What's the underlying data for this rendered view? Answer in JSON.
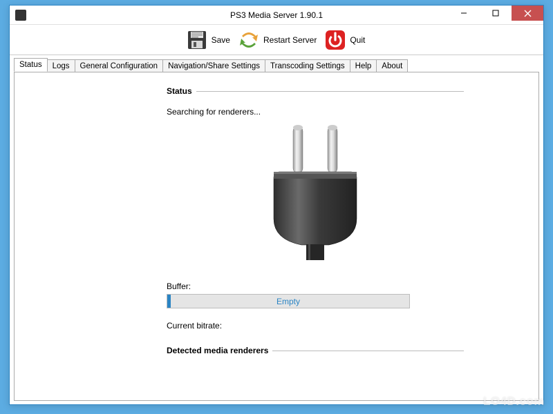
{
  "window": {
    "title": "PS3 Media Server 1.90.1"
  },
  "toolbar": {
    "save_label": "Save",
    "restart_label": "Restart Server",
    "quit_label": "Quit"
  },
  "tabs": [
    {
      "label": "Status",
      "active": true
    },
    {
      "label": "Logs"
    },
    {
      "label": "General Configuration"
    },
    {
      "label": "Navigation/Share Settings"
    },
    {
      "label": "Transcoding Settings"
    },
    {
      "label": "Help"
    },
    {
      "label": "About"
    }
  ],
  "status": {
    "section_label": "Status",
    "searching_text": "Searching for renderers...",
    "buffer_label": "Buffer:",
    "buffer_value": "Empty",
    "bitrate_label": "Current bitrate:",
    "detected_label": "Detected media renderers"
  },
  "watermark": "LO4D.com"
}
